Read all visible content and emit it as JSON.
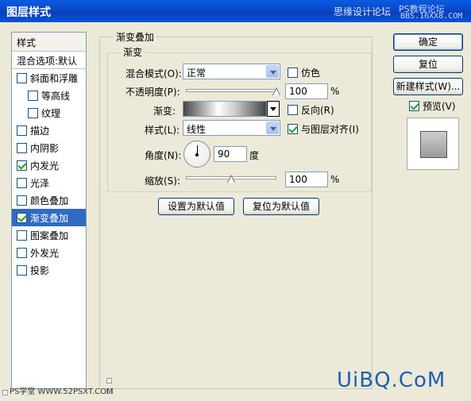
{
  "window": {
    "title": "图层样式",
    "watermark_top": "思缘设计论坛",
    "watermark_top2": "PS教程论坛",
    "watermark_top3": "BBS.16XX8.COM"
  },
  "style_list": {
    "header": "样式",
    "blending_options": "混合选项:默认",
    "items": [
      {
        "label": "斜面和浮雕",
        "checked": false,
        "sub": false,
        "selected": false
      },
      {
        "label": "等高线",
        "checked": false,
        "sub": true,
        "selected": false
      },
      {
        "label": "纹理",
        "checked": false,
        "sub": true,
        "selected": false
      },
      {
        "label": "描边",
        "checked": false,
        "sub": false,
        "selected": false
      },
      {
        "label": "内阴影",
        "checked": false,
        "sub": false,
        "selected": false
      },
      {
        "label": "内发光",
        "checked": true,
        "sub": false,
        "selected": false
      },
      {
        "label": "光泽",
        "checked": false,
        "sub": false,
        "selected": false
      },
      {
        "label": "颜色叠加",
        "checked": false,
        "sub": false,
        "selected": false
      },
      {
        "label": "渐变叠加",
        "checked": true,
        "sub": false,
        "selected": true
      },
      {
        "label": "图案叠加",
        "checked": false,
        "sub": false,
        "selected": false
      },
      {
        "label": "外发光",
        "checked": false,
        "sub": false,
        "selected": false
      },
      {
        "label": "投影",
        "checked": false,
        "sub": false,
        "selected": false
      }
    ]
  },
  "gradient_overlay": {
    "section_title": "渐变叠加",
    "group_title": "渐变",
    "blend_mode_label": "混合模式(O):",
    "blend_mode_value": "正常",
    "dither_label": "仿色",
    "dither_checked": false,
    "opacity_label": "不透明度(P):",
    "opacity_value": "100",
    "opacity_unit": "%",
    "opacity_fraction": 1.0,
    "gradient_label": "渐变:",
    "reverse_label": "反向(R)",
    "reverse_checked": false,
    "style_label": "样式(L):",
    "style_value": "线性",
    "align_label": "与图层对齐(I)",
    "align_checked": true,
    "angle_label": "角度(N):",
    "angle_value": "90",
    "angle_unit": "度",
    "scale_label": "缩放(S):",
    "scale_value": "100",
    "scale_unit": "%",
    "scale_fraction": 0.5,
    "make_default": "设置为默认值",
    "reset_default": "复位为默认值"
  },
  "buttons": {
    "ok": "确定",
    "reset": "复位",
    "new_style": "新建样式(W)...",
    "preview_label": "预览(V)",
    "preview_checked": true
  },
  "watermarks": {
    "bottom_left": "PS学堂 WWW.52PSXT.COM",
    "bottom_right": "UiBQ.CoM"
  }
}
